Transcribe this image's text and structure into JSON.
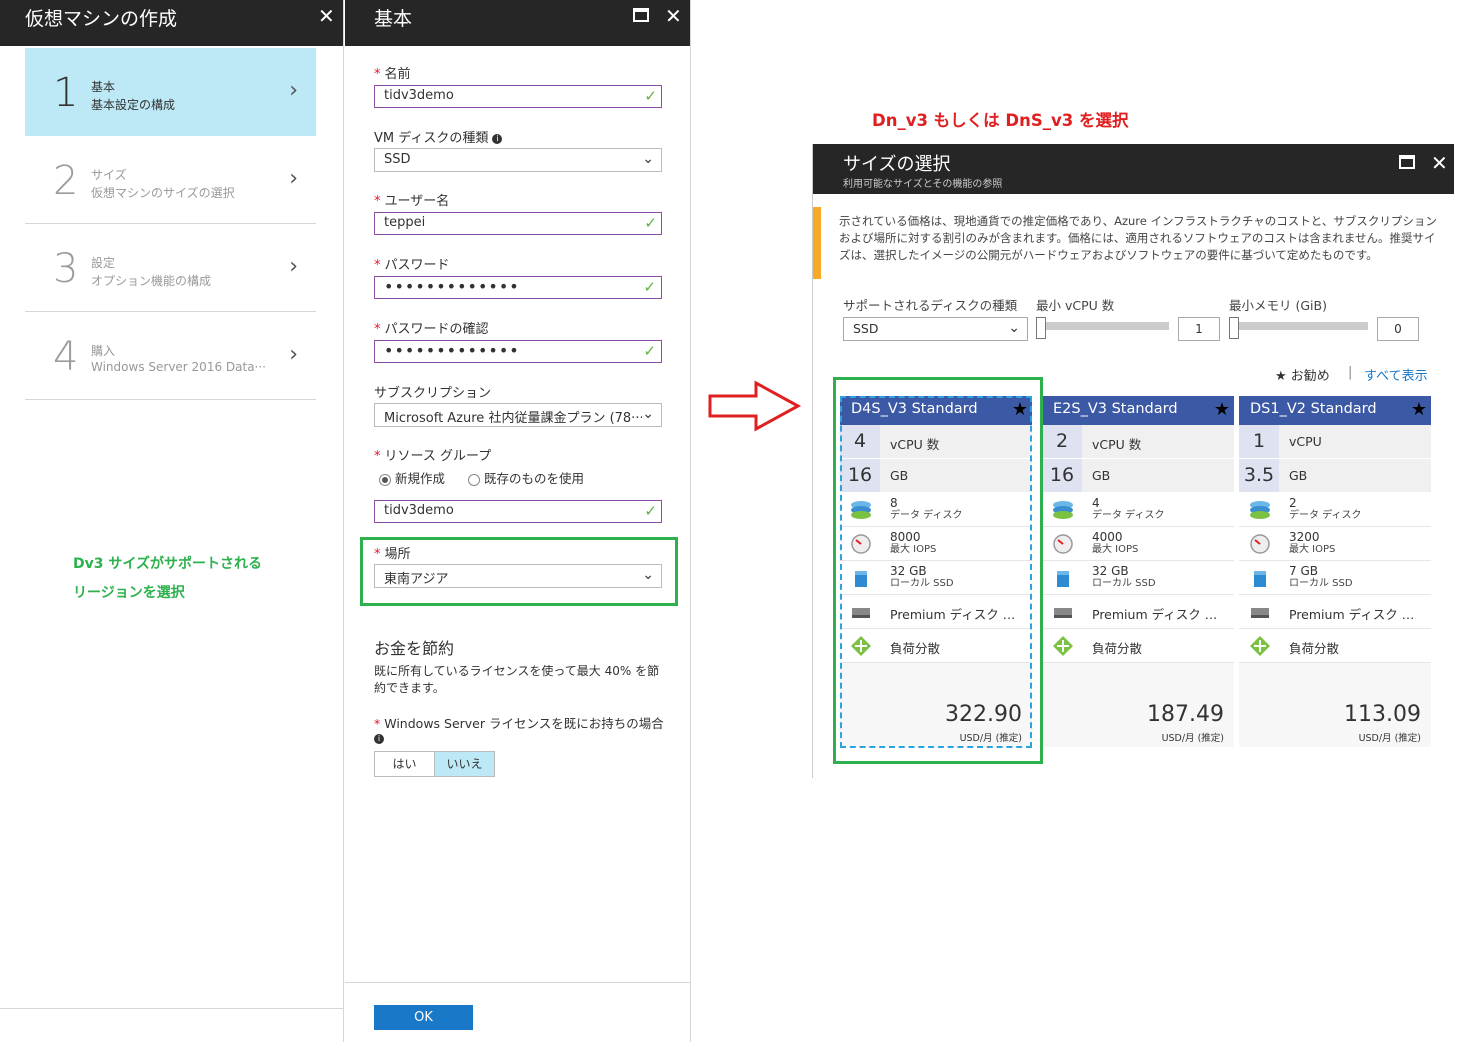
{
  "panel1": {
    "title": "仮想マシンの作成",
    "steps": [
      {
        "num": "1",
        "title": "基本",
        "sub": "基本設定の構成"
      },
      {
        "num": "2",
        "title": "サイズ",
        "sub": "仮想マシンのサイズの選択"
      },
      {
        "num": "3",
        "title": "設定",
        "sub": "オプション機能の構成"
      },
      {
        "num": "4",
        "title": "購入",
        "sub": "Windows Server 2016 Data···"
      }
    ],
    "annotation_line1": "Dv3 サイズがサポートされる",
    "annotation_line2": "リージョンを選択"
  },
  "panel2": {
    "title": "基本",
    "name_label": "名前",
    "name_value": "tidv3demo",
    "disk_label": "VM ディスクの種類",
    "disk_value": "SSD",
    "user_label": "ユーザー名",
    "user_value": "teppei",
    "pw_label": "パスワード",
    "pw_value": "•••••••••••••",
    "pwc_label": "パスワードの確認",
    "pwc_value": "•••••••••••••",
    "sub_label": "サブスクリプション",
    "sub_value": "Microsoft Azure 社内従量課金プラン (78···",
    "rg_label": "リソース グループ",
    "rg_new": "新規作成",
    "rg_existing": "既存のものを使用",
    "rg_value": "tidv3demo",
    "loc_label": "場所",
    "loc_value": "東南アジア",
    "save_title": "お金を節約",
    "save_desc": "既に所有しているライセンスを使って最大 40% を節約できます。",
    "license_label": "Windows Server ライセンスを既にお持ちの場合",
    "yes": "はい",
    "no": "いいえ",
    "ok": "OK"
  },
  "annotation_top": "Dn_v3 もしくは DnS_v3 を選択",
  "panel3": {
    "title": "サイズの選択",
    "subtitle": "利用可能なサイズとその機能の参照",
    "notice": "示されている価格は、現地通貨での推定価格であり、Azure インフラストラクチャのコストと、サブスクリプションおよび場所に対する割引のみが含まれます。価格には、適用されるソフトウェアのコストは含まれません。推奨サイズは、選択したイメージの公開元がハードウェアおよびソフトウェアの要件に基づいて定めたものです。",
    "disk_filter_label": "サポートされるディスクの種類",
    "disk_filter_value": "SSD",
    "vcpu_label": "最小 vCPU 数",
    "vcpu_value": "1",
    "mem_label": "最小メモリ (GiB)",
    "mem_value": "0",
    "recommended": "★ お勧め",
    "separator": "|",
    "show_all": "すべて表示",
    "cards": [
      {
        "name": "D4S_V3  Standard",
        "vcpu": "4",
        "vcpu_unit": "vCPU 数",
        "mem": "16",
        "mem_unit": "GB",
        "disks": "8",
        "disks_label": "データ ディスク",
        "iops": "8000",
        "iops_label": "最大 IOPS",
        "ssd": "32 GB",
        "ssd_label": "ローカル SSD",
        "premium": "Premium ディスク サポ···",
        "lb": "負荷分散",
        "price": "322.90",
        "price_unit": "USD/月 (推定)"
      },
      {
        "name": "E2S_V3  Standard",
        "vcpu": "2",
        "vcpu_unit": "vCPU 数",
        "mem": "16",
        "mem_unit": "GB",
        "disks": "4",
        "disks_label": "データ ディスク",
        "iops": "4000",
        "iops_label": "最大 IOPS",
        "ssd": "32 GB",
        "ssd_label": "ローカル SSD",
        "premium": "Premium ディスク サポ···",
        "lb": "負荷分散",
        "price": "187.49",
        "price_unit": "USD/月 (推定)"
      },
      {
        "name": "DS1_V2  Standard",
        "vcpu": "1",
        "vcpu_unit": "vCPU",
        "mem": "3.5",
        "mem_unit": "GB",
        "disks": "2",
        "disks_label": "データ ディスク",
        "iops": "3200",
        "iops_label": "最大 IOPS",
        "ssd": "7 GB",
        "ssd_label": "ローカル SSD",
        "premium": "Premium ディスク サポ···",
        "lb": "負荷分散",
        "price": "113.09",
        "price_unit": "USD/月 (推定)"
      }
    ]
  },
  "colors": {
    "header": "#262626",
    "active_step": "#bde9f6",
    "card_header": "#3c59a6",
    "annotation_green": "#2eb14d",
    "annotation_red": "#e02020",
    "ok_button": "#1978c8",
    "notice_bar": "#f7a928"
  }
}
